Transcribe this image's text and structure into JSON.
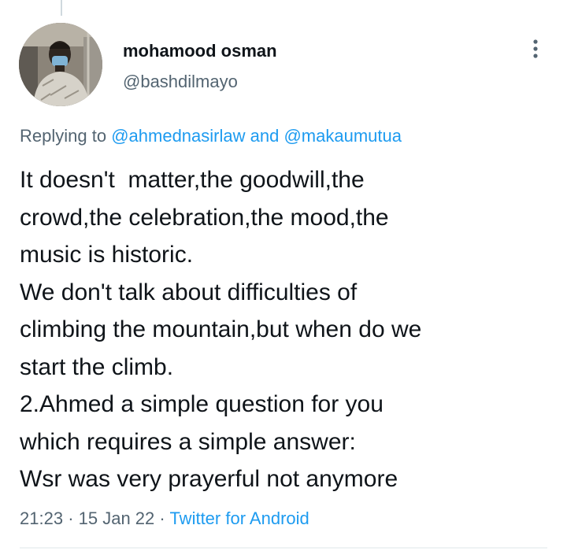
{
  "tweet": {
    "display_name": "mohamood osman",
    "handle": "@bashdilmayo",
    "replying_prefix": "Replying to",
    "reply_mentions": [
      "@ahmednasirlaw",
      "@makaumutua"
    ],
    "reply_joiner": "and",
    "text_lines": [
      "It doesn't  matter,the goodwill,the",
      "crowd,the celebration,the mood,the",
      "music is historic.",
      "We don't talk about difficulties of",
      "climbing the mountain,but when do we",
      "start the climb.",
      "2.Ahmed a simple question for you",
      "which requires a simple answer:",
      "Wsr was very prayerful not anymore"
    ],
    "time": "21:23",
    "date": "15 Jan 22",
    "separator": "·",
    "source": "Twitter for Android"
  },
  "icons": {
    "avatar": "user-avatar-photo",
    "more": "more-vertical-icon"
  },
  "colors": {
    "text_primary": "#0f1419",
    "text_secondary": "#536471",
    "link": "#1d9bf0",
    "divider": "#eff3f4",
    "thread_line": "#cfd9de"
  }
}
